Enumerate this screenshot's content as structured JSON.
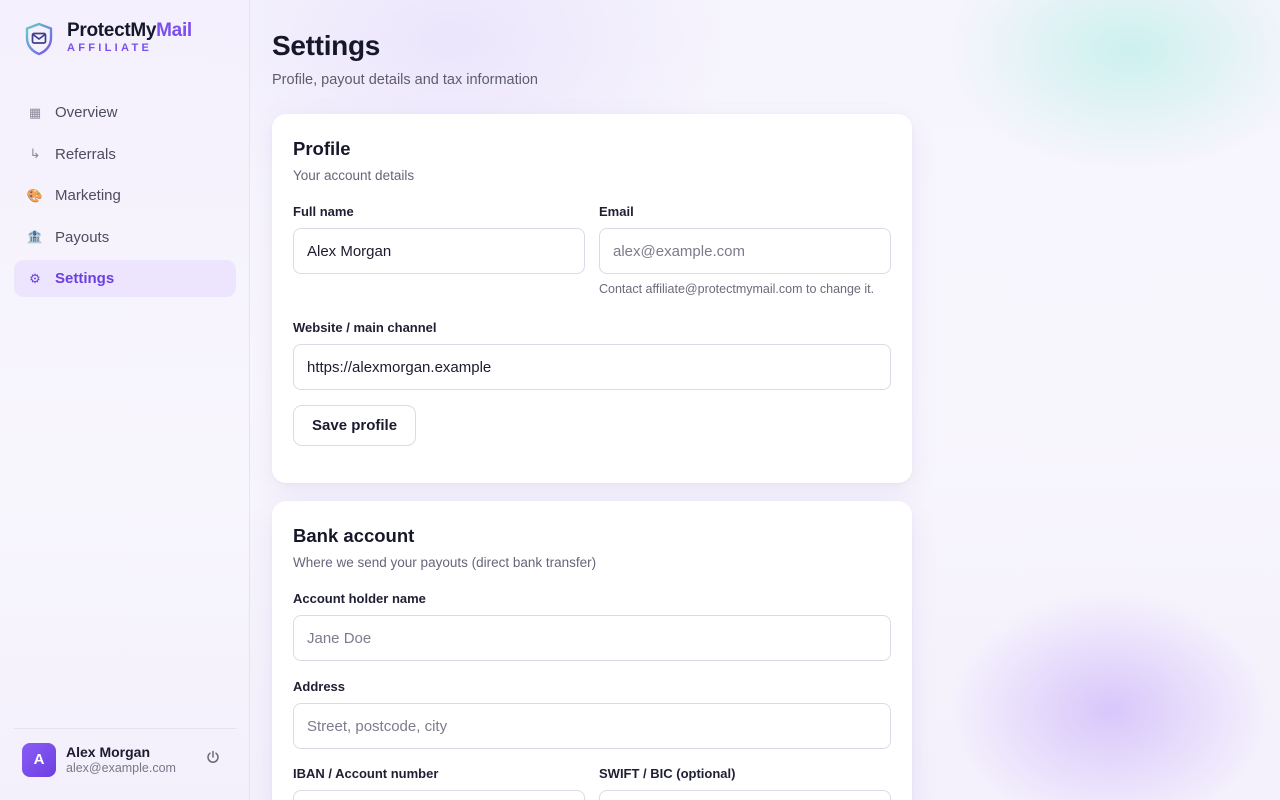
{
  "brand": {
    "name_part1": "ProtectMy",
    "name_part2": "Mail",
    "subtitle": "AFFILIATE",
    "icon": "shield-mail-icon",
    "accent_color": "#7b4ff0"
  },
  "sidebar": {
    "items": [
      {
        "label": "Overview",
        "icon": "grid-icon",
        "glyph": "▦",
        "active": false
      },
      {
        "label": "Referrals",
        "icon": "return-arrow-icon",
        "glyph": "↳",
        "active": false
      },
      {
        "label": "Marketing",
        "icon": "palette-icon",
        "glyph": "🎨",
        "active": false
      },
      {
        "label": "Payouts",
        "icon": "bank-icon",
        "glyph": "🏦",
        "active": false
      },
      {
        "label": "Settings",
        "icon": "gear-icon",
        "glyph": "⚙",
        "active": true
      }
    ]
  },
  "user": {
    "initial": "A",
    "name": "Alex Morgan",
    "email": "alex@example.com",
    "logout_icon": "power-icon"
  },
  "page": {
    "title": "Settings",
    "subtitle": "Profile, payout details and tax information"
  },
  "profile": {
    "title": "Profile",
    "subtitle": "Your account details",
    "full_name_label": "Full name",
    "full_name_value": "Alex Morgan",
    "email_label": "Email",
    "email_placeholder": "alex@example.com",
    "email_hint": "Contact affiliate@protectmymail.com to change it.",
    "website_label": "Website / main channel",
    "website_value": "https://alexmorgan.example",
    "save_label": "Save profile"
  },
  "bank": {
    "title": "Bank account",
    "subtitle": "Where we send your payouts (direct bank transfer)",
    "holder_label": "Account holder name",
    "holder_placeholder": "Jane Doe",
    "address_label": "Address",
    "address_placeholder": "Street, postcode, city",
    "iban_label": "IBAN / Account number",
    "swift_label": "SWIFT / BIC (optional)"
  }
}
